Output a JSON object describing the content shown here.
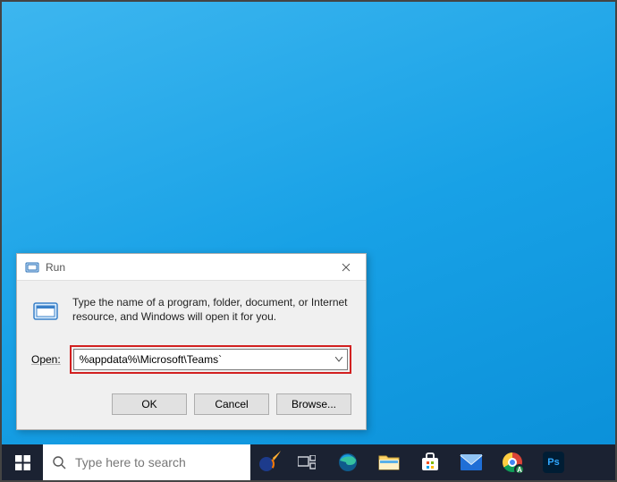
{
  "dialog": {
    "title": "Run",
    "message": "Type the name of a program, folder, document, or Internet resource, and Windows will open it for you.",
    "open_label": "Open:",
    "input_value": "%appdata%\\Microsoft\\Teams`",
    "ok_label": "OK",
    "cancel_label": "Cancel",
    "browse_label": "Browse..."
  },
  "taskbar": {
    "search_placeholder": "Type here to search"
  },
  "icons": {
    "run": "run-icon",
    "close": "close-icon",
    "chevron_down": "chevron-down-icon",
    "start": "windows-start-icon",
    "search": "search-icon",
    "cortana": "cortana-comet-icon",
    "taskview": "taskview-icon",
    "edge": "edge-icon",
    "explorer": "file-explorer-icon",
    "store": "microsoft-store-icon",
    "mail": "mail-icon",
    "chrome": "chrome-icon",
    "photoshop": "photoshop-icon"
  },
  "colors": {
    "highlight_border": "#d22020",
    "taskbar_bg": "#1b2232",
    "desktop_bg": "#18a1e6"
  }
}
